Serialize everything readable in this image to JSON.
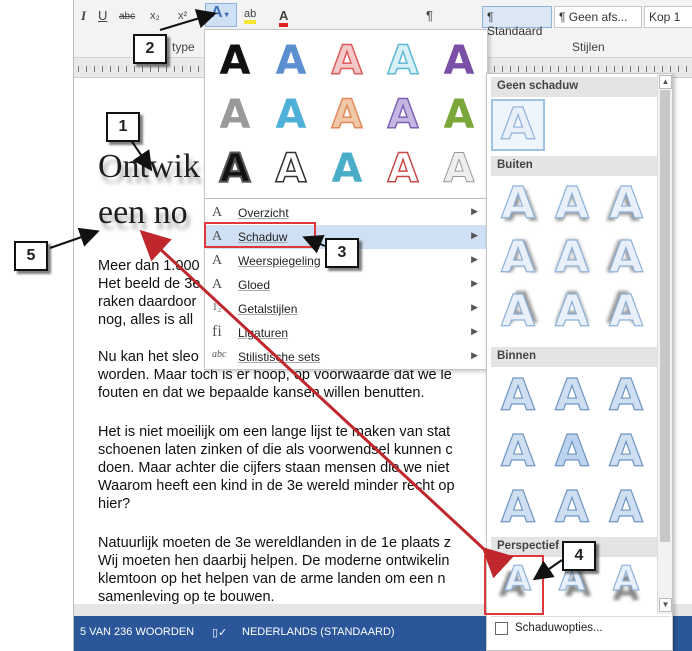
{
  "ribbon": {
    "italic": "I",
    "underline": "U",
    "strike": "abc",
    "subscript": "x₂",
    "superscript": "x²",
    "text_effects_icon": "A",
    "highlight_icon": "ab",
    "font_color_icon": "A",
    "para_icon": "¶",
    "styles": [
      "¶ Standaard",
      "¶ Geen afs...",
      "Kop 1"
    ],
    "group_font_suffix": "type",
    "group_styles": "Stijlen"
  },
  "document": {
    "title_line1": "Ontwik",
    "title_line2": "een no",
    "paragraphs": [
      "Meer dan 1.000\nHet beeld de 3e\nraken daardoor\nnog, alles is all",
      "Nu kan het sleo\nworden. Maar toch is er hoop, op voorwaarde dat we le\nfouten en dat we bepaalde kansen willen benutten.",
      "Het is niet moeilijk om een lange lijst te maken van stat\nschoenen laten zinken of die als voorwendsel kunnen c\ndoen. Maar achter die cijfers staan mensen die we niet\nWaarom heeft een kind in de 3e wereld minder recht op\nhier?",
      "Natuurlijk moeten de 3e wereldlanden in de 1e plaats z\nWij moeten hen daarbij helpen. De moderne ontwikelin\nklemtoon op het helpen van de arme landen om een n\nsamenleving op te bouwen."
    ]
  },
  "status": {
    "words": "5 VAN 236 WOORDEN",
    "language": "NEDERLANDS (STANDAARD)"
  },
  "menu": {
    "items": [
      {
        "icon": "A",
        "label": "Overzicht"
      },
      {
        "icon": "A",
        "label": "Schaduw"
      },
      {
        "icon": "A",
        "label": "Weerspiegeling"
      },
      {
        "icon": "A",
        "label": "Gloed"
      },
      {
        "icon": "1₂",
        "label": "Getalstijlen"
      },
      {
        "icon": "fi",
        "label": "Ligaturen"
      },
      {
        "icon": "abc",
        "label": "Stilistische sets"
      }
    ]
  },
  "gallery": {
    "glyph": "A"
  },
  "shadow_submenu": {
    "sections": [
      "Geen schaduw",
      "Buiten",
      "Binnen",
      "Perspectief"
    ],
    "glyph": "A",
    "options_label": "Schaduwopties..."
  },
  "callouts": [
    "1",
    "2",
    "3",
    "4",
    "5"
  ],
  "colors": {
    "status_bar": "#2b579a",
    "highlight": "#e0373a",
    "arrow": "#c0272d"
  }
}
